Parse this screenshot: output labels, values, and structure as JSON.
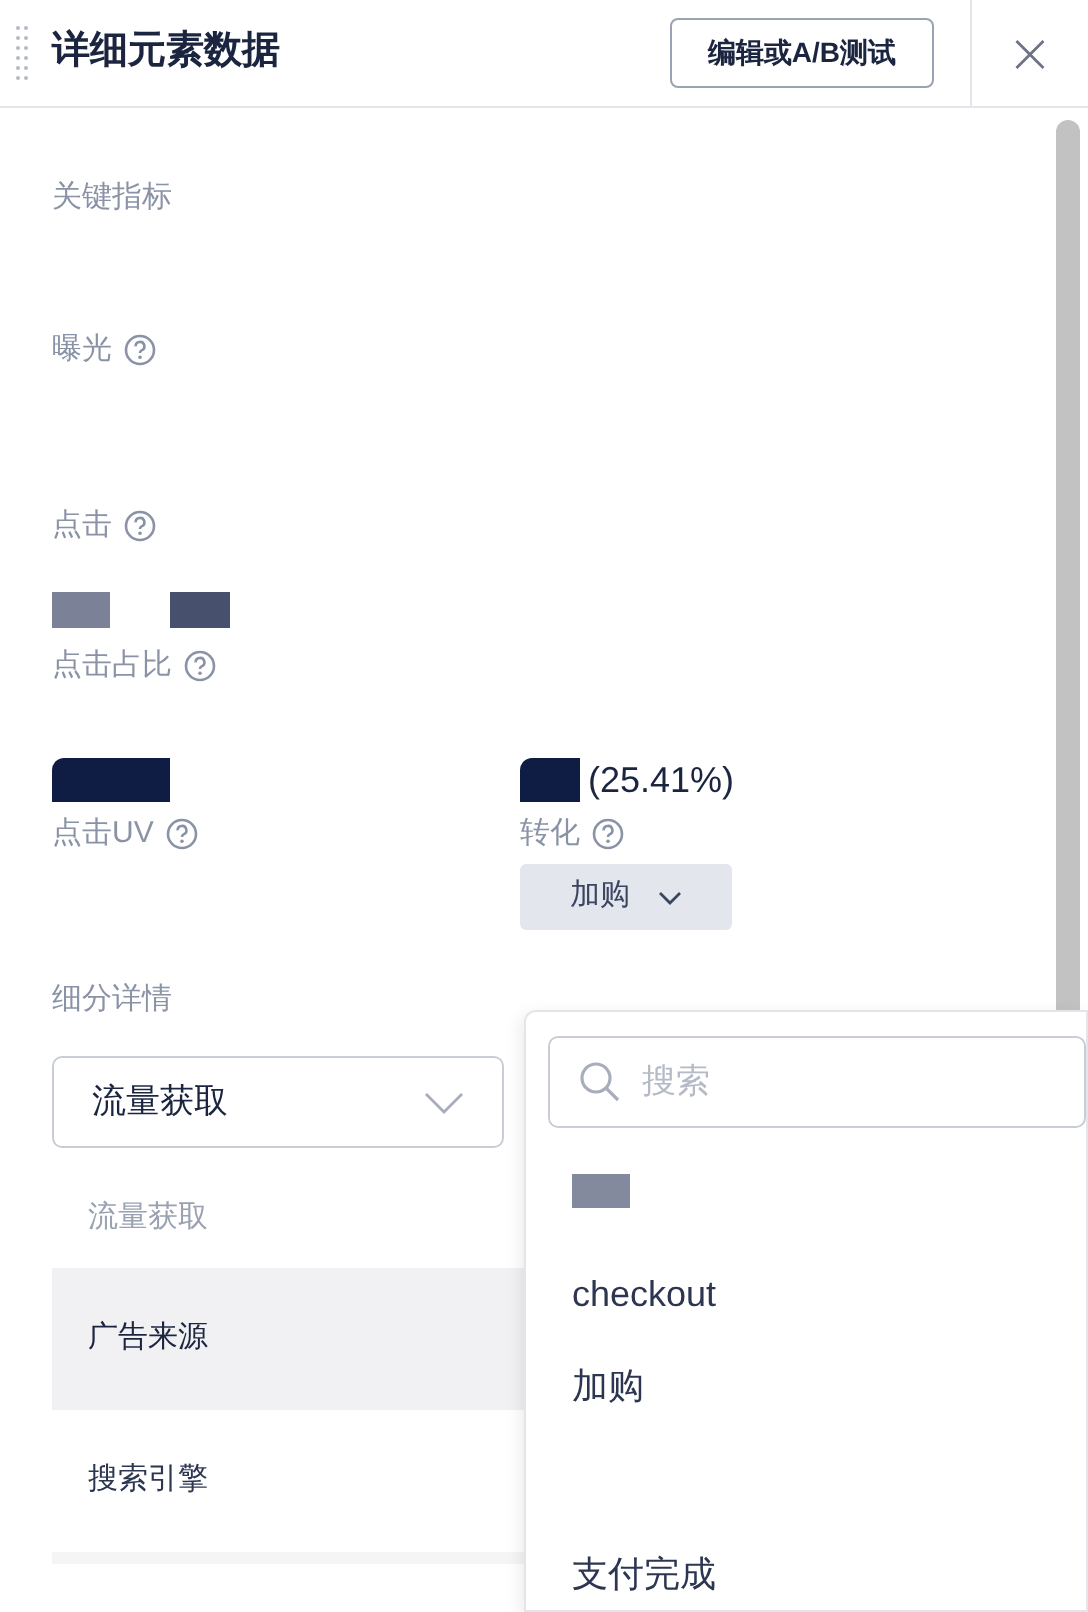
{
  "header": {
    "title": "详细元素数据",
    "action_button": "编辑或A/B测试",
    "close": "×"
  },
  "section_title": "关键指标",
  "metrics": [
    {
      "label": "曝光",
      "redacted": false
    },
    {
      "label": "点击",
      "redacted": false
    },
    {
      "label": "点击占比",
      "redacted": true
    }
  ],
  "metric_pair": [
    {
      "label": "点击UV",
      "redacted": true
    },
    {
      "label": "转化",
      "redacted": true,
      "suffix": "(25.41%)",
      "event_button": "加购"
    }
  ],
  "breakdown": {
    "title": "细分详情",
    "select_value": "流量获取",
    "items": [
      {
        "kind": "group",
        "label": "流量获取"
      },
      {
        "kind": "option",
        "label": "广告来源",
        "selected": true
      },
      {
        "kind": "option",
        "label": "搜索引擎",
        "selected": false
      }
    ]
  },
  "event_dropdown": {
    "placeholder": "搜索",
    "items": [
      {
        "kind": "redacted"
      },
      {
        "kind": "text",
        "label": "checkout"
      },
      {
        "kind": "text",
        "label": "加购"
      },
      {
        "kind": "blank"
      },
      {
        "kind": "text",
        "label": "支付完成"
      }
    ]
  }
}
